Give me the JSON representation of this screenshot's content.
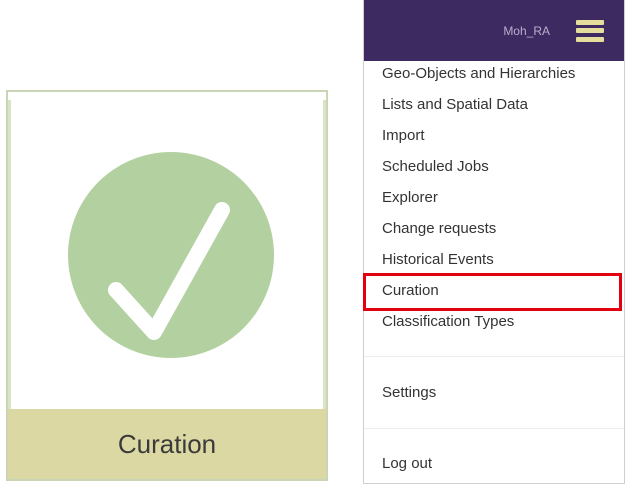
{
  "tile": {
    "label": "Curation",
    "icon": "checkmark-circle-icon",
    "colors": {
      "circle": "#b3d1a0",
      "check": "#ffffff",
      "footer": "#dcd8a3",
      "border": "#c9d5b5"
    }
  },
  "menu": {
    "user": "Moh_RA",
    "header_color": "#3d2a60",
    "hamburger_color": "#e4dd9c",
    "items": [
      {
        "label": "Geo-Objects and Hierarchies"
      },
      {
        "label": "Lists and Spatial Data"
      },
      {
        "label": "Import"
      },
      {
        "label": "Scheduled Jobs"
      },
      {
        "label": "Explorer"
      },
      {
        "label": "Change requests"
      },
      {
        "label": "Historical Events"
      },
      {
        "label": "Curation",
        "highlighted": true
      },
      {
        "label": "Classification Types"
      }
    ],
    "settings_label": "Settings",
    "logout_label": "Log out",
    "highlight_color": "#e3000f"
  }
}
